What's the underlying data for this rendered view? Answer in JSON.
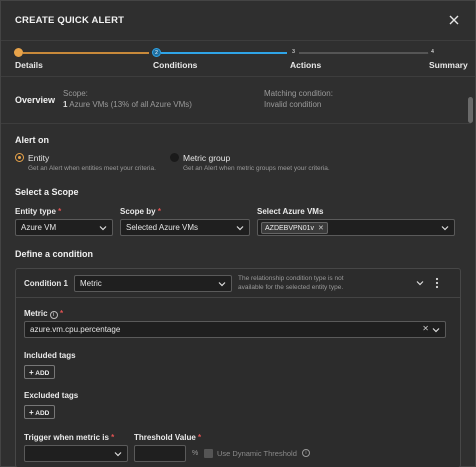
{
  "dialog": {
    "title": "CREATE QUICK ALERT"
  },
  "steps": [
    {
      "num": "1",
      "label": "Details",
      "state": "done"
    },
    {
      "num": "2",
      "label": "Conditions",
      "state": "active"
    },
    {
      "num": "3",
      "label": "Actions",
      "state": "pending"
    },
    {
      "num": "4",
      "label": "Summary",
      "state": "pending"
    }
  ],
  "overview": {
    "title": "Overview",
    "scope_label": "Scope:",
    "scope_count": "1",
    "scope_text": "Azure VMs (13% of all Azure VMs)",
    "matching_label": "Matching condition:",
    "matching_value": "Invalid condition"
  },
  "alert_on": {
    "title": "Alert on",
    "options": [
      {
        "label": "Entity",
        "desc": "Get an Alert when entities meet your criteria.",
        "selected": true
      },
      {
        "label": "Metric group",
        "desc": "Get an Alert when metric groups meet your criteria.",
        "selected": false
      }
    ]
  },
  "scope": {
    "title": "Select a Scope",
    "entity_type_label": "Entity type",
    "entity_type_value": "Azure VM",
    "scope_by_label": "Scope by",
    "scope_by_value": "Selected Azure VMs",
    "vms_label": "Select Azure VMs",
    "vms_chip": "AZDEBVPN01v"
  },
  "condition": {
    "title": "Define a condition",
    "name": "Condition 1",
    "type_value": "Metric",
    "note": "The relationship condition type is not available for the selected entity type.",
    "metric_label": "Metric",
    "metric_value": "azure.vm.cpu.percentage",
    "included_tags_label": "Included tags",
    "excluded_tags_label": "Excluded tags",
    "add_label": "ADD",
    "trigger_label": "Trigger when metric is",
    "threshold_label": "Threshold Value",
    "unit": "%",
    "dynamic_label": "Use Dynamic Threshold"
  },
  "colors": {
    "accent_orange": "#e8a34a",
    "accent_blue": "#2fa4e7",
    "required": "#e05252"
  }
}
